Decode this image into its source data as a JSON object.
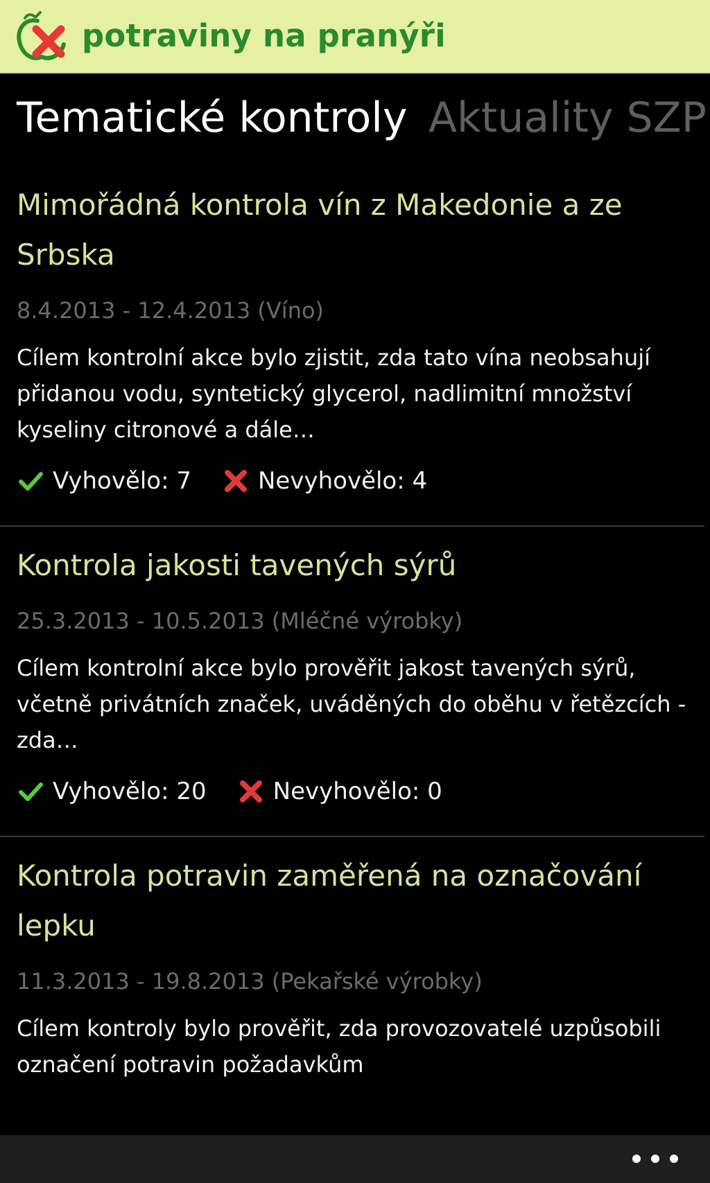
{
  "header": {
    "app_title": "potraviny na pranýři",
    "logo_icon": "apple-cross-icon",
    "background_color": "#e6f0a3",
    "title_color": "#2a8a2e"
  },
  "pivot": {
    "tabs": [
      {
        "label": "Tematické kontroly",
        "active": true
      },
      {
        "label": "Aktuality SZPI",
        "active": false
      }
    ]
  },
  "items": [
    {
      "title": "Mimořádná kontrola vín z Makedonie a ze Srbska",
      "date": "8.4.2013 - 12.4.2013 (Víno)",
      "description": "Cílem kontrolní akce bylo zjistit, zda tato vína neobsahují přidanou vodu, syntetický glycerol, nadlimitní množství kyseliny citronové a dále…",
      "passed_label": "Vyhovělo: 7",
      "failed_label": "Nevyhovělo: 4"
    },
    {
      "title": "Kontrola jakosti tavených sýrů",
      "date": "25.3.2013 - 10.5.2013 (Mléčné výrobky)",
      "description": "Cílem kontrolní akce bylo prověřit jakost tavených sýrů, včetně privátních značek, uváděných do oběhu v řetězcích - zda…",
      "passed_label": "Vyhovělo: 20",
      "failed_label": "Nevyhovělo: 0"
    },
    {
      "title": "Kontrola potravin zaměřená na označování lepku",
      "date": "11.3.2013 - 19.8.2013 (Pekařské výrobky)",
      "description": "Cílem kontroly bylo prověřit, zda provozovatelé uzpůsobili označení potravin požadavkům",
      "passed_label": "",
      "failed_label": ""
    }
  ],
  "icons": {
    "passed": "checkmark-icon",
    "failed": "cross-icon",
    "more": "more-dots-icon"
  },
  "colors": {
    "title_accent": "#d8e29a",
    "passed": "#5cc83b",
    "failed": "#e03a3a",
    "date": "#6b6b6b"
  }
}
